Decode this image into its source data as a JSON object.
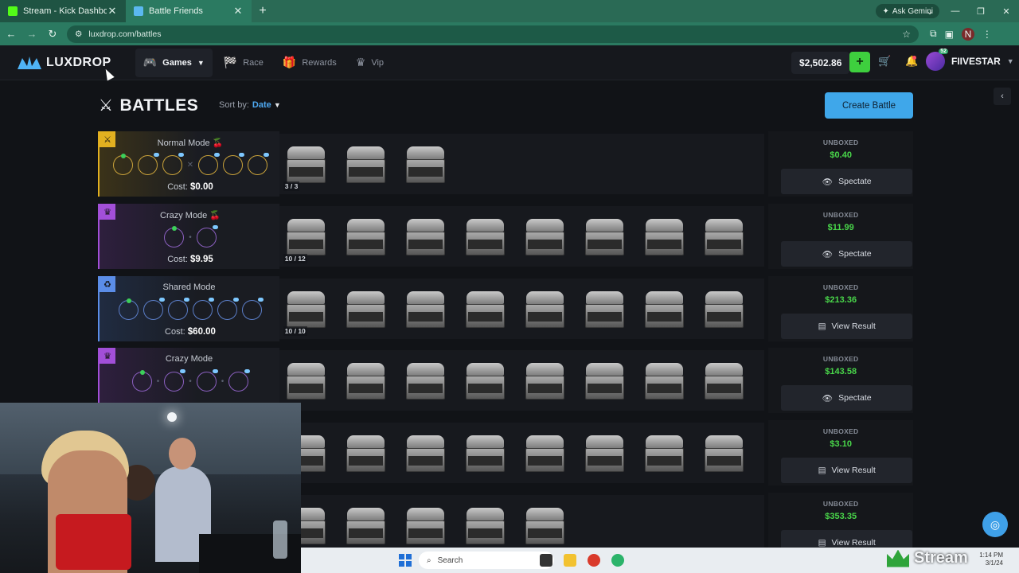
{
  "browser": {
    "tabs": [
      {
        "title": "Stream - Kick Dashboard",
        "favicon_color": "#53fc18",
        "active": false
      },
      {
        "title": "Battle Friends",
        "favicon_color": "#5bb8f0",
        "active": true
      }
    ],
    "new_tab": "+",
    "gemini": "Ask Gemini",
    "url": "luxdrop.com/battles",
    "profile_initial": "N"
  },
  "header": {
    "logo": "LUXDROP",
    "nav": [
      {
        "label": "Games",
        "icon": "gamepad-icon",
        "active": true
      },
      {
        "label": "Race",
        "icon": "race-icon",
        "active": false
      },
      {
        "label": "Rewards",
        "icon": "gift-icon",
        "active": false
      },
      {
        "label": "Vip",
        "icon": "crown-icon",
        "active": false
      }
    ],
    "balance": "$2,502.86",
    "deposit": "+",
    "username": "FIIVESTAR",
    "level": "52"
  },
  "page": {
    "title": "BATTLES",
    "sort_label": "Sort by:",
    "sort_value": "Date",
    "create_button": "Create Battle"
  },
  "battles": [
    {
      "mode": "Normal Mode",
      "cherry": "🍒",
      "cost_label": "Cost:",
      "cost": "$0.00",
      "accent": "#e2b020",
      "counter": "3 / 3",
      "unboxed_label": "UNBOXED",
      "unboxed": "$0.40",
      "action": "Spectate",
      "action_icon": "eye-icon"
    },
    {
      "mode": "Crazy Mode",
      "cherry": "🍒",
      "cost_label": "Cost:",
      "cost": "$9.95",
      "accent": "#a24fd8",
      "counter": "10 / 12",
      "unboxed_label": "UNBOXED",
      "unboxed": "$11.99",
      "action": "Spectate",
      "action_icon": "eye-icon"
    },
    {
      "mode": "Shared Mode",
      "cherry": "",
      "cost_label": "Cost:",
      "cost": "$60.00",
      "accent": "#5b8de8",
      "counter": "10 / 10",
      "unboxed_label": "UNBOXED",
      "unboxed": "$213.36",
      "action": "View Result",
      "action_icon": "receipt-icon"
    },
    {
      "mode": "Crazy Mode",
      "cherry": "",
      "cost_label": "",
      "cost": "",
      "accent": "#a24fd8",
      "counter": "",
      "unboxed_label": "UNBOXED",
      "unboxed": "$143.58",
      "action": "Spectate",
      "action_icon": "eye-icon"
    },
    {
      "mode": "",
      "cherry": "",
      "cost_label": "",
      "cost": "",
      "accent": "#3a3f48",
      "counter": "",
      "unboxed_label": "UNBOXED",
      "unboxed": "$3.10",
      "action": "View Result",
      "action_icon": "receipt-icon"
    },
    {
      "mode": "",
      "cherry": "",
      "cost_label": "",
      "cost": "",
      "accent": "#3a3f48",
      "counter": "",
      "unboxed_label": "UNBOXED",
      "unboxed": "$353.35",
      "action": "View Result",
      "action_icon": "receipt-icon"
    }
  ],
  "taskbar": {
    "search": "Search",
    "time": "1:14 PM",
    "date": "3/1/24"
  },
  "watermark": "Stream"
}
